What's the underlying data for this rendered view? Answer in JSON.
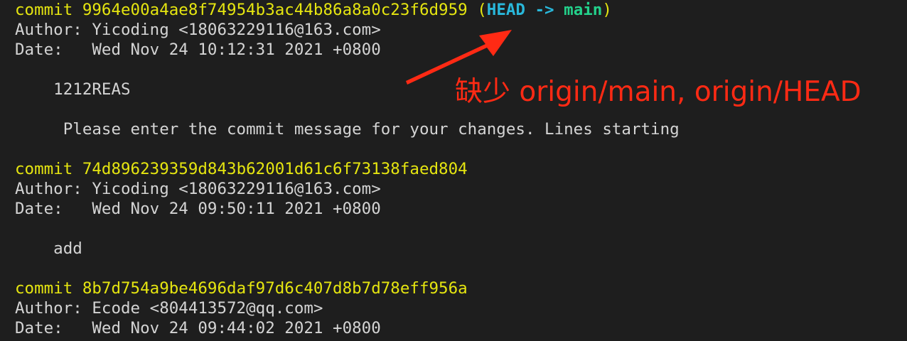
{
  "terminal": {
    "commits": [
      {
        "commit_label": "commit ",
        "hash": "9964e00a4ae8f74954b3ac44b86a8a0c23f6d959",
        "refs_open": " (",
        "ref_head": "HEAD",
        "ref_arrow": " -> ",
        "ref_branch": "main",
        "refs_close": ")",
        "author": "Author: Yicoding <18063229116@163.com>",
        "date": "Date:   Wed Nov 24 10:12:31 2021 +0800",
        "message_lines": [
          "    1212REAS",
          "     Please enter the commit message for your changes. Lines starting"
        ]
      },
      {
        "commit_label": "commit ",
        "hash": "74d896239359d843b62001d61c6f73138faed804",
        "author": "Author: Yicoding <18063229116@163.com>",
        "date": "Date:   Wed Nov 24 09:50:11 2021 +0800",
        "message_lines": [
          "    add"
        ]
      },
      {
        "commit_label": "commit ",
        "hash": "8b7d754a9be4696daf97d6c407d8b7d78eff956a",
        "author": "Author: Ecode <804413572@qq.com>",
        "date": "Date:   Wed Nov 24 09:44:02 2021 +0800"
      }
    ]
  },
  "annotation": {
    "text": "缺少 origin/main, origin/HEAD",
    "color": "#ff2a14"
  },
  "colors": {
    "background": "#1e1e1e",
    "text": "#d4d4d4",
    "commit_yellow": "#e5e510",
    "head_cyan": "#29b8db",
    "branch_green": "#23d18b"
  }
}
